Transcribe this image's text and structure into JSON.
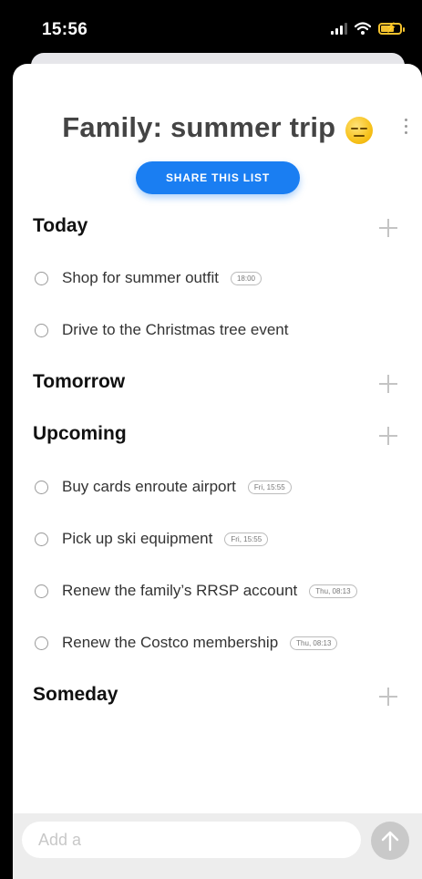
{
  "status_bar": {
    "time": "15:56"
  },
  "list": {
    "title": "Family: summer trip",
    "title_emoji": "expressionless-face-emoji",
    "share_label": "SHARE THIS LIST"
  },
  "sections": {
    "today": {
      "title": "Today",
      "tasks": [
        {
          "text": "Shop for summer outfit",
          "badge": "18:00"
        },
        {
          "text": "Drive to the Christmas tree event",
          "badge": ""
        }
      ]
    },
    "tomorrow": {
      "title": "Tomorrow",
      "tasks": []
    },
    "upcoming": {
      "title": "Upcoming",
      "tasks": [
        {
          "text": "Buy cards enroute airport",
          "badge": "Fri, 15:55"
        },
        {
          "text": "Pick up ski equipment",
          "badge": "Fri, 15:55"
        },
        {
          "text": "Renew the family’s RRSP account",
          "badge": "Thu, 08:13"
        },
        {
          "text": "Renew the Costco membership",
          "badge": "Thu, 08:13"
        }
      ]
    },
    "someday": {
      "title": "Someday",
      "tasks": []
    }
  },
  "composer": {
    "placeholder": "Add a ",
    "value": ""
  },
  "colors": {
    "accent": "#1a7ef2",
    "battery": "#f2c12e",
    "send_disabled": "#c9c9c9"
  },
  "icons": {
    "signal": "cellular-signal-icon",
    "wifi": "wifi-icon",
    "battery": "battery-charging-icon",
    "add": "plus-icon",
    "more": "more-vertical-icon",
    "send": "arrow-up-icon"
  }
}
